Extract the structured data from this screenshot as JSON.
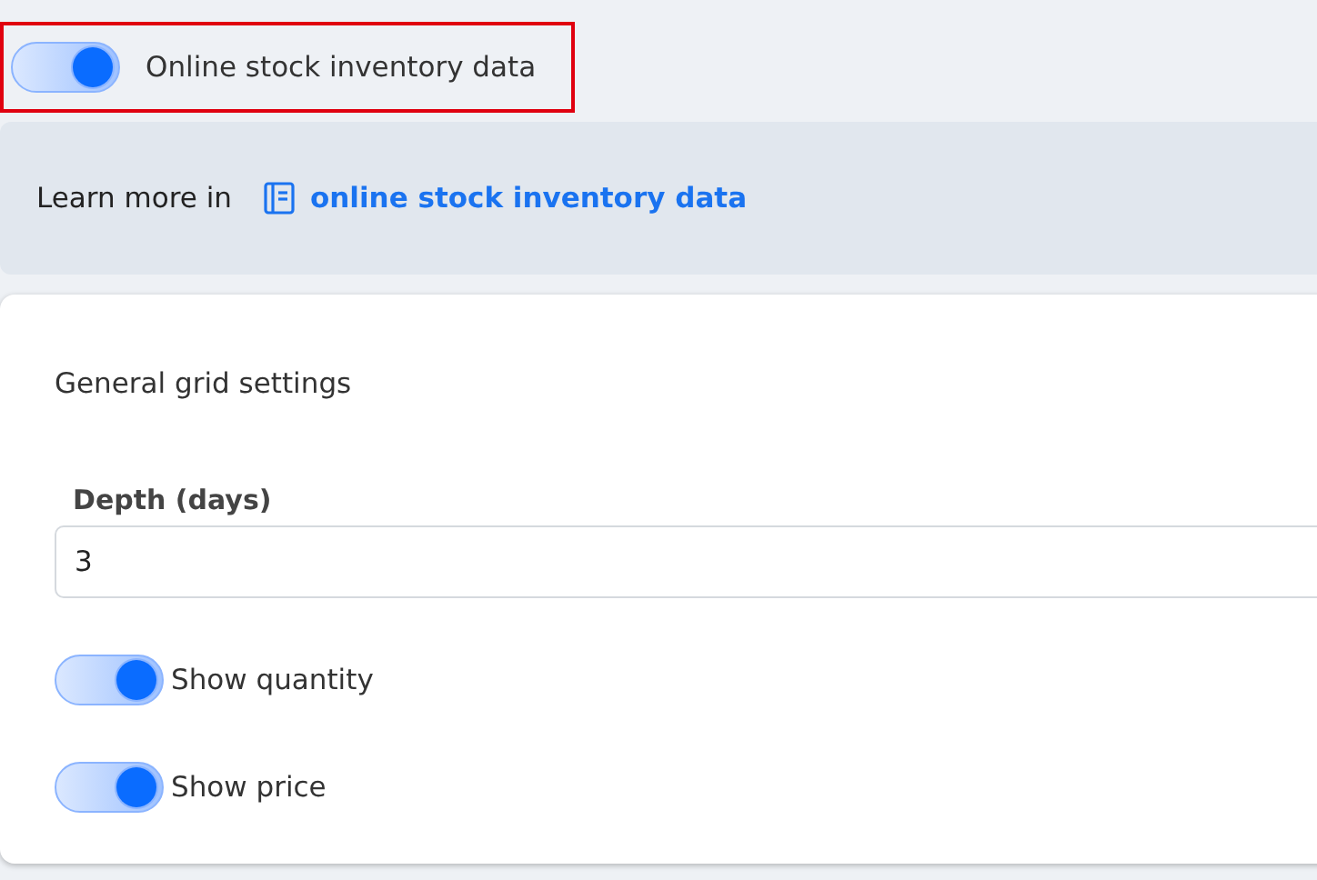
{
  "main_toggle": {
    "label": "Online stock inventory data",
    "on": true,
    "highlighted": true
  },
  "info": {
    "text": "Learn more in",
    "link": "online stock inventory data"
  },
  "card": {
    "title": "General grid settings",
    "depth": {
      "label": "Depth (days)",
      "value": "3"
    },
    "toggles": [
      {
        "label": "Show quantity",
        "on": true
      },
      {
        "label": "Show price",
        "on": true
      }
    ]
  }
}
